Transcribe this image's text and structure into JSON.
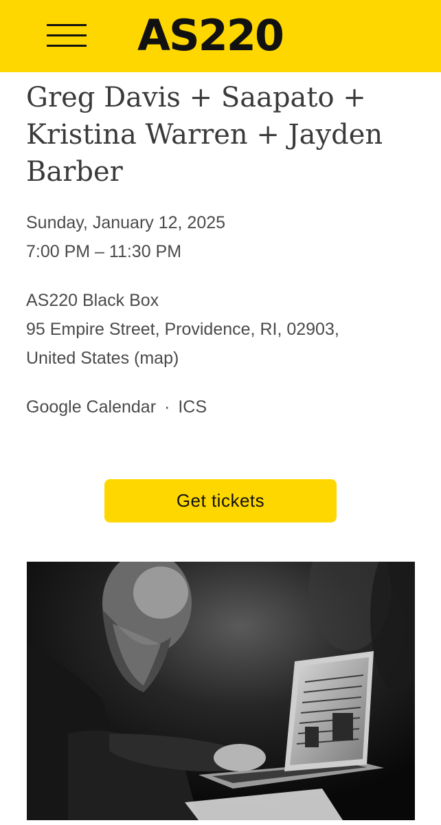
{
  "header": {
    "logo_text": "AS220",
    "menu_icon": "hamburger-menu-icon",
    "background_color": "#fed700"
  },
  "event": {
    "title": "Greg Davis + Saapato + Kristina Warren + Jayden Barber",
    "date": "Sunday, January 12, 2025",
    "time": "7:00 PM – 11:30 PM",
    "venue_name": "AS220 Black Box",
    "address_line1": "95 Empire Street, Providence, RI, 02903,",
    "address_line2_prefix": "United States ",
    "map_link": "(map)",
    "calendar_links": {
      "google": "Google Calendar",
      "separator": "·",
      "ics": "ICS"
    },
    "tickets_label": "Get tickets",
    "accent_color": "#fed700",
    "photo": {
      "description_icon": "event-photo"
    }
  }
}
